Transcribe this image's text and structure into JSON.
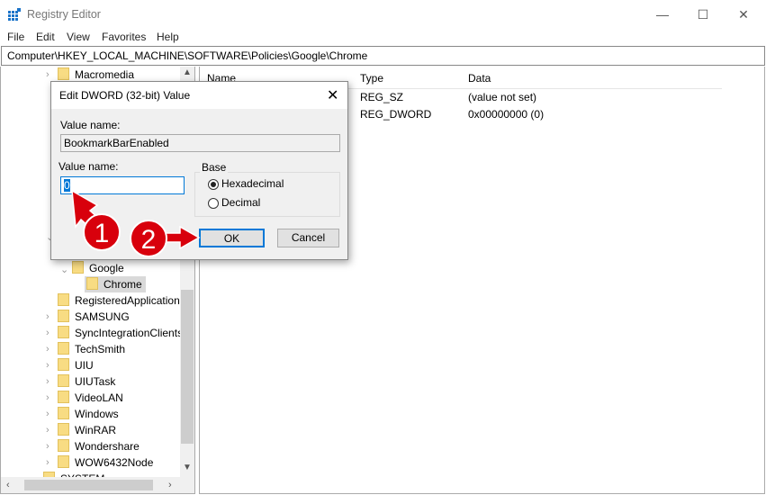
{
  "window": {
    "title": "Registry Editor",
    "minimize": "—",
    "maximize": "☐",
    "close": "✕"
  },
  "menu": [
    "File",
    "Edit",
    "View",
    "Favorites",
    "Help"
  ],
  "address": "Computer\\HKEY_LOCAL_MACHINE\\SOFTWARE\\Policies\\Google\\Chrome",
  "tree": {
    "top": "Macromedia",
    "google": "Google",
    "chrome": "Chrome",
    "items": [
      "RegisteredApplications",
      "SAMSUNG",
      "SyncIntegrationClients",
      "TechSmith",
      "UIU",
      "UIUTask",
      "VideoLAN",
      "Windows",
      "WinRAR",
      "Wondershare",
      "WOW6432Node"
    ],
    "bottom": "SYSTEM"
  },
  "list": {
    "headers": [
      "Name",
      "Type",
      "Data"
    ],
    "rows": [
      {
        "type": "REG_SZ",
        "data": "(value not set)"
      },
      {
        "type": "REG_DWORD",
        "data": "0x00000000 (0)"
      }
    ]
  },
  "dialog": {
    "title": "Edit DWORD (32-bit) Value",
    "name_label": "Value name:",
    "name_value": "BookmarkBarEnabled",
    "data_label": "Value name:",
    "data_value": "0",
    "base_label": "Base",
    "hex": "Hexadecimal",
    "dec": "Decimal",
    "ok": "OK",
    "cancel": "Cancel",
    "selected_base": "Hexadecimal"
  },
  "annotations": {
    "step1": "1",
    "step2": "2",
    "color": "#d8000c"
  }
}
